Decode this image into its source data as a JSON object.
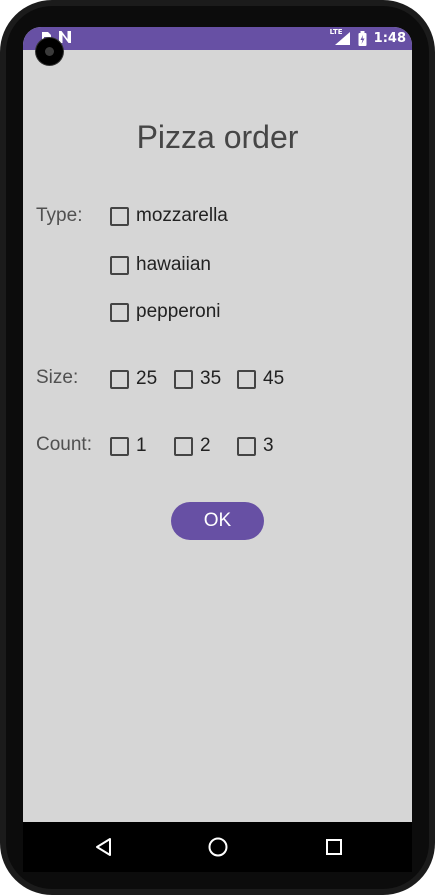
{
  "status_bar": {
    "left_icons": [
      "sim-icon",
      "n-notification-icon"
    ],
    "network": "LTE",
    "time": "1:48"
  },
  "app": {
    "title": "Pizza order",
    "type_label": "Type:",
    "size_label": "Size:",
    "count_label": "Count:",
    "types": [
      "mozzarella",
      "hawaiian",
      "pepperoni"
    ],
    "sizes": [
      "25",
      "35",
      "45"
    ],
    "counts": [
      "1",
      "2",
      "3"
    ],
    "ok_label": "OK"
  },
  "nav": {
    "icons": [
      "back-icon",
      "home-icon",
      "recents-icon"
    ]
  },
  "colors": {
    "accent": "#6750a4",
    "background": "#d6d6d6"
  }
}
